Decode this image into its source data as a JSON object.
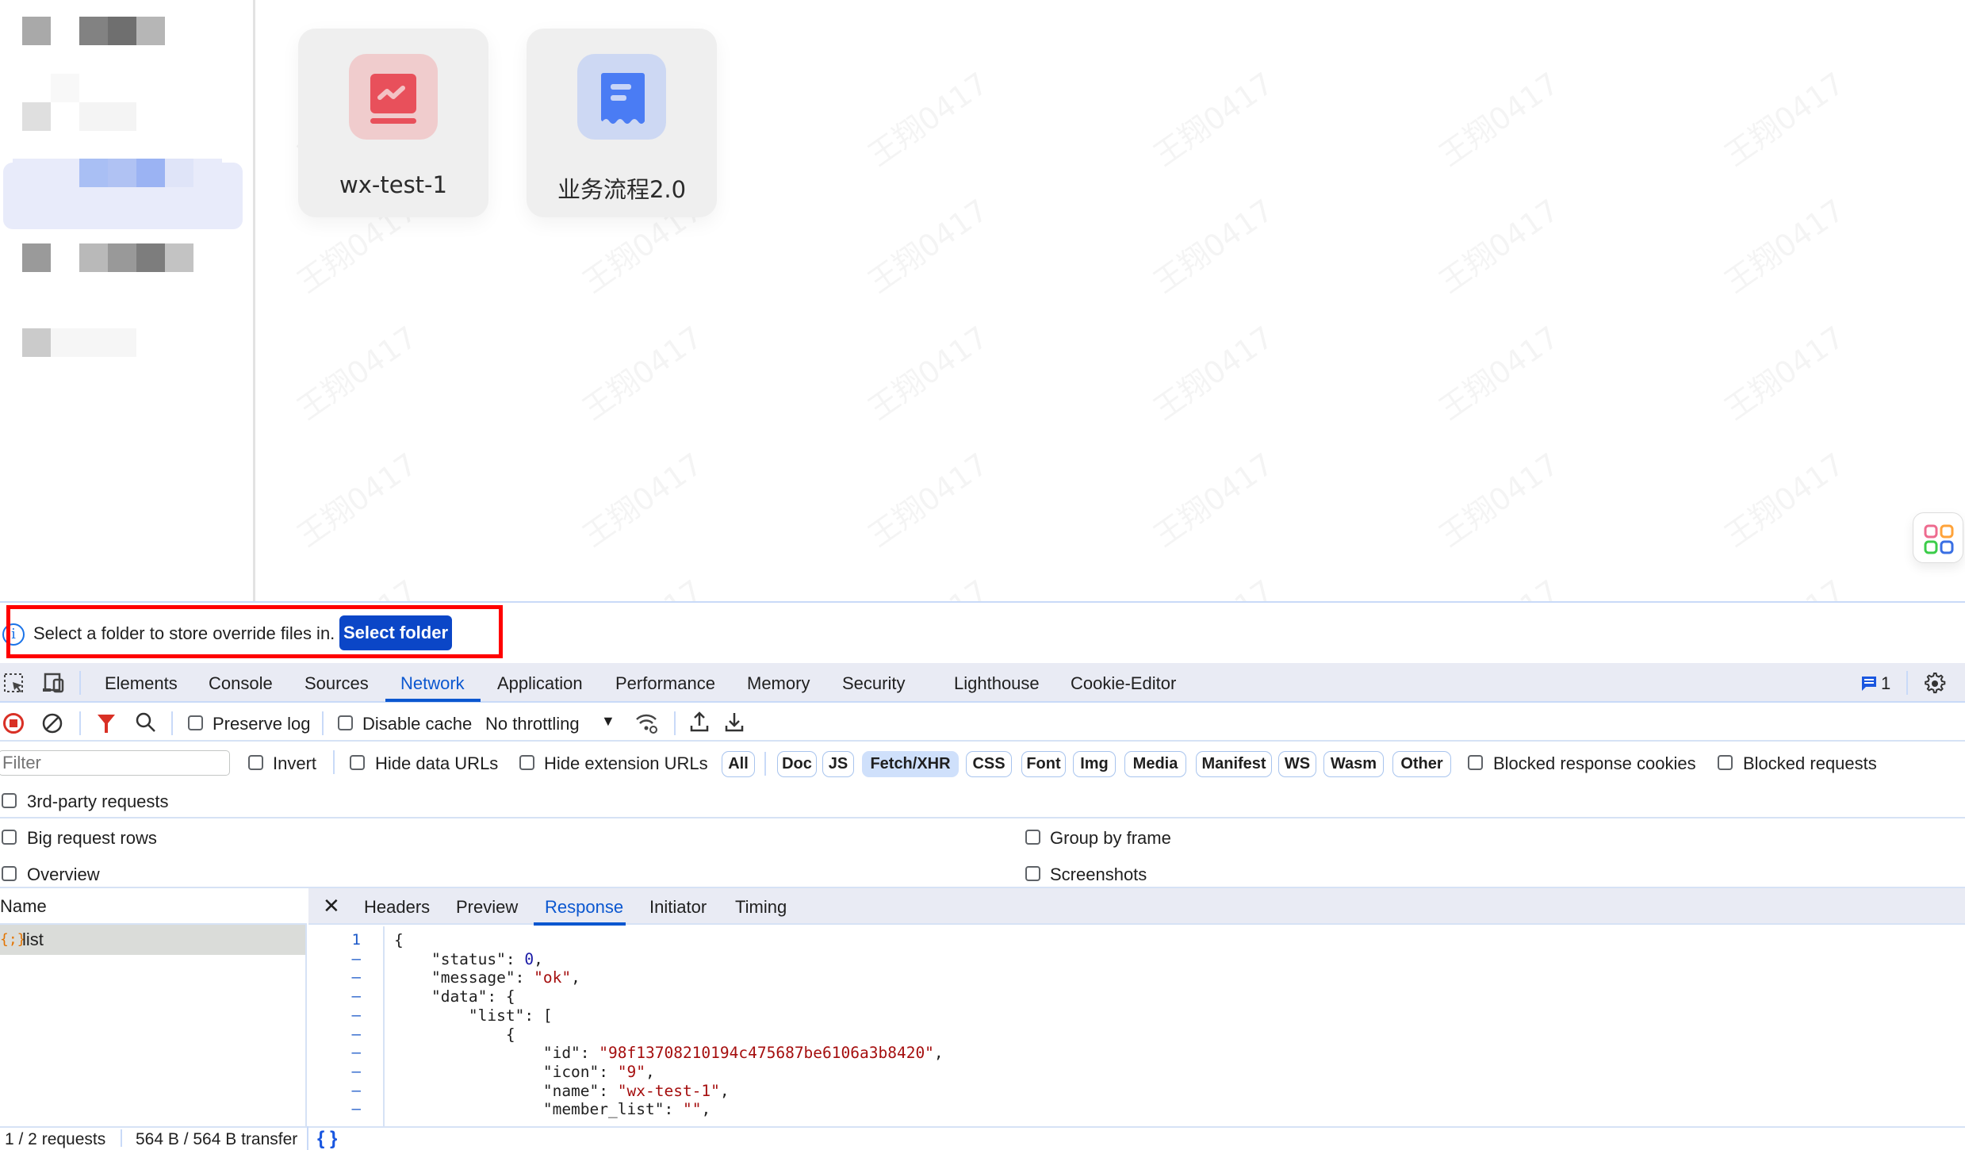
{
  "app": {
    "cards": [
      {
        "name": "wx-test-1",
        "icon": "chart-board-icon",
        "icon_bg": "#f0cccd",
        "icon_color": "#e8505b"
      },
      {
        "name": "业务流程2.0",
        "icon": "receipt-document-icon",
        "icon_bg": "#cdd8f3",
        "icon_color": "#4a7cf4"
      }
    ],
    "watermark_text": "王翔0417",
    "floating_button_icon": "apps-grid-icon"
  },
  "devtools": {
    "infobar": {
      "message": "Select a folder to store override files in.",
      "button_label": "Select folder"
    },
    "tabs": [
      {
        "label": "Elements"
      },
      {
        "label": "Console"
      },
      {
        "label": "Sources"
      },
      {
        "label": "Network",
        "active": true
      },
      {
        "label": "Application"
      },
      {
        "label": "Performance"
      },
      {
        "label": "Memory"
      },
      {
        "label": "Security"
      },
      {
        "label": "Lighthouse"
      },
      {
        "label": "Cookie-Editor"
      }
    ],
    "issues_count": "1",
    "toolbar": {
      "preserve_log": "Preserve log",
      "disable_cache": "Disable cache",
      "throttling": "No throttling"
    },
    "filter": {
      "placeholder": "Filter",
      "invert": "Invert",
      "hide_data_urls": "Hide data URLs",
      "hide_extension_urls": "Hide extension URLs",
      "types": [
        "All",
        "Doc",
        "JS",
        "Fetch/XHR",
        "CSS",
        "Font",
        "Img",
        "Media",
        "Manifest",
        "WS",
        "Wasm",
        "Other"
      ],
      "active_type": "Fetch/XHR",
      "blocked_response_cookies": "Blocked response cookies",
      "blocked_requests": "Blocked requests"
    },
    "settings": {
      "third_party": "3rd-party requests",
      "big_rows": "Big request rows",
      "group_by_frame": "Group by frame",
      "overview": "Overview",
      "screenshots": "Screenshots"
    },
    "requests": {
      "name_header": "Name",
      "items": [
        {
          "name": "list"
        }
      ]
    },
    "detail_tabs": [
      {
        "label": "Headers"
      },
      {
        "label": "Preview"
      },
      {
        "label": "Response",
        "active": true
      },
      {
        "label": "Initiator"
      },
      {
        "label": "Timing"
      }
    ],
    "response_lines": [
      {
        "gutter": "1",
        "indent": "",
        "key": "{",
        "value": "",
        "type": "plain",
        "tail": ""
      },
      {
        "gutter": "–",
        "indent": "    ",
        "key": "\"status\": ",
        "value": "0",
        "type": "num",
        "tail": ","
      },
      {
        "gutter": "–",
        "indent": "    ",
        "key": "\"message\": ",
        "value": "\"ok\"",
        "type": "str",
        "tail": ","
      },
      {
        "gutter": "–",
        "indent": "    ",
        "key": "\"data\": {",
        "value": "",
        "type": "plain",
        "tail": ""
      },
      {
        "gutter": "–",
        "indent": "        ",
        "key": "\"list\": [",
        "value": "",
        "type": "plain",
        "tail": ""
      },
      {
        "gutter": "–",
        "indent": "            ",
        "key": "{",
        "value": "",
        "type": "plain",
        "tail": ""
      },
      {
        "gutter": "–",
        "indent": "                ",
        "key": "\"id\": ",
        "value": "\"98f13708210194c475687be6106a3b8420\"",
        "type": "str",
        "tail": ","
      },
      {
        "gutter": "–",
        "indent": "                ",
        "key": "\"icon\": ",
        "value": "\"9\"",
        "type": "str",
        "tail": ","
      },
      {
        "gutter": "–",
        "indent": "                ",
        "key": "\"name\": ",
        "value": "\"wx-test-1\"",
        "type": "str",
        "tail": ","
      },
      {
        "gutter": "–",
        "indent": "                ",
        "key": "\"member_list\": ",
        "value": "\"\"",
        "type": "str",
        "tail": ","
      }
    ],
    "status": {
      "requests": "1 / 2 requests",
      "transferred": "564 B / 564 B transfer",
      "pretty_print": "{ }"
    }
  }
}
